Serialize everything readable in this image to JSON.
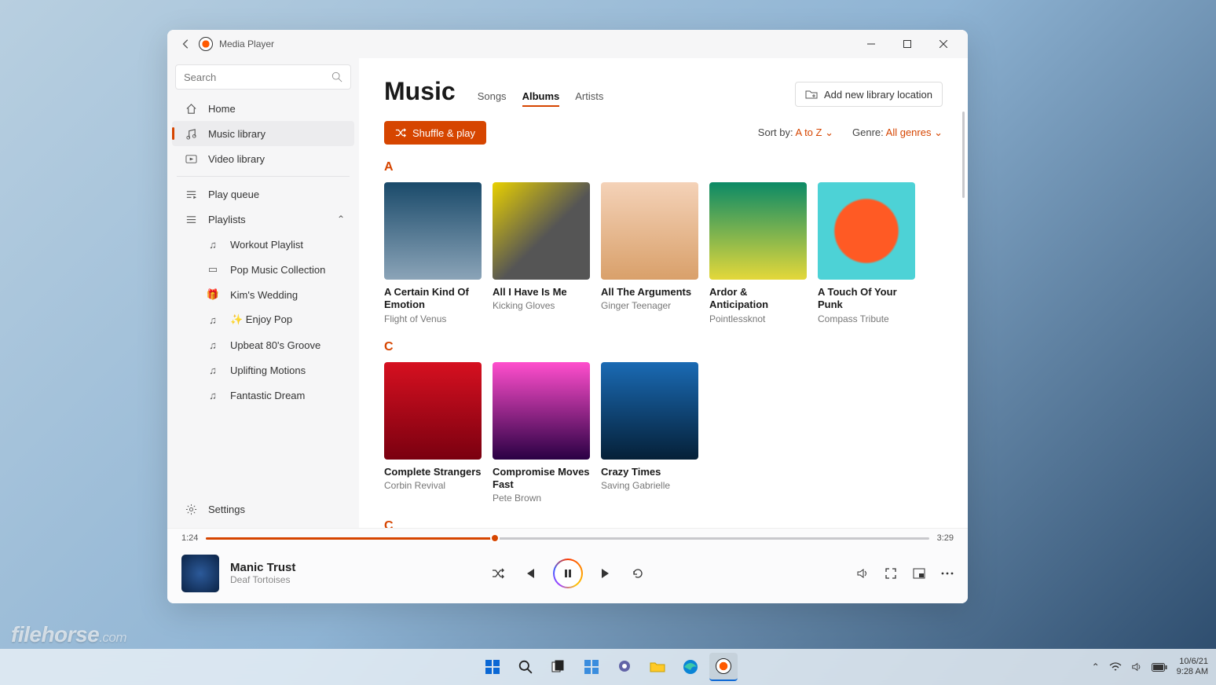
{
  "app": {
    "title": "Media Player"
  },
  "search": {
    "placeholder": "Search"
  },
  "sidebar": {
    "home": "Home",
    "music_library": "Music library",
    "video_library": "Video library",
    "play_queue": "Play queue",
    "playlists_label": "Playlists",
    "playlists": [
      "Workout Playlist",
      "Pop Music Collection",
      "Kim's Wedding",
      "✨ Enjoy Pop",
      "Upbeat 80's Groove",
      "Uplifting Motions",
      "Fantastic Dream"
    ],
    "settings": "Settings"
  },
  "header": {
    "title": "Music",
    "tabs": {
      "songs": "Songs",
      "albums": "Albums",
      "artists": "Artists"
    },
    "add_location": "Add new library location"
  },
  "toolbar": {
    "shuffle": "Shuffle & play",
    "sort_label": "Sort by:",
    "sort_value": "A to Z",
    "genre_label": "Genre:",
    "genre_value": "All genres"
  },
  "sections": {
    "a": {
      "letter": "A",
      "albums": [
        {
          "title": "A Certain Kind Of Emotion",
          "artist": "Flight of Venus"
        },
        {
          "title": "All I Have Is Me",
          "artist": "Kicking Gloves"
        },
        {
          "title": "All The Arguments",
          "artist": "Ginger Teenager"
        },
        {
          "title": "Ardor & Anticipation",
          "artist": "Pointlessknot"
        },
        {
          "title": "A Touch Of Your Punk",
          "artist": "Compass Tribute"
        }
      ]
    },
    "c": {
      "letter": "C",
      "albums": [
        {
          "title": "Complete Strangers",
          "artist": "Corbin Revival"
        },
        {
          "title": "Compromise Moves Fast",
          "artist": "Pete Brown"
        },
        {
          "title": "Crazy Times",
          "artist": "Saving Gabrielle"
        }
      ]
    },
    "c2": {
      "letter": "C"
    }
  },
  "player": {
    "elapsed": "1:24",
    "total": "3:29",
    "title": "Manic Trust",
    "artist": "Deaf Tortoises"
  },
  "tray": {
    "date": "10/6/21",
    "time": "9:28 AM"
  },
  "watermark": {
    "main": "filehorse",
    "sub": ".com"
  }
}
